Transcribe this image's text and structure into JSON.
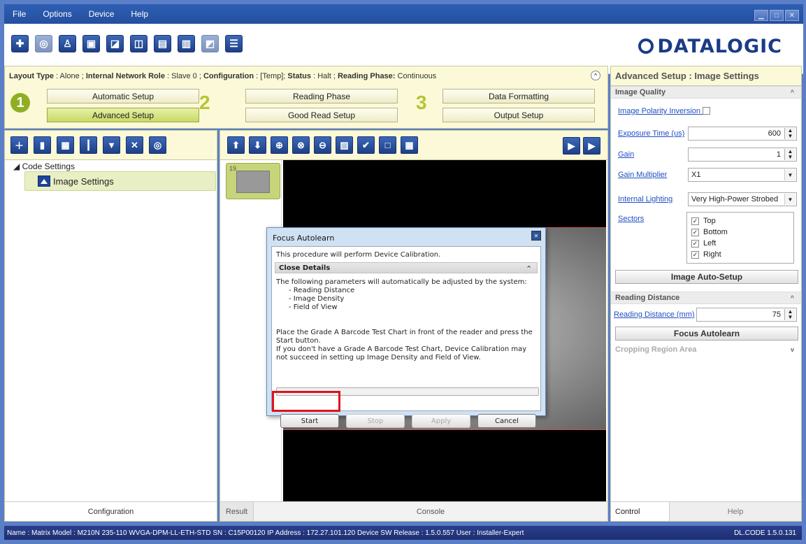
{
  "menu": [
    "File",
    "Options",
    "Device",
    "Help"
  ],
  "brand": {
    "logo_text": "DATALOGIC"
  },
  "layout_info": {
    "layout_type_label": "Layout Type",
    "layout_type_value": "Alone",
    "network_role_label": "Internal Network Role",
    "network_role_value": "Slave 0",
    "configuration_label": "Configuration",
    "configuration_value": "[Temp]",
    "status_label": "Status",
    "status_value": "Halt",
    "reading_phase_label": "Reading Phase:",
    "reading_phase_value": "Continuous"
  },
  "steps": {
    "step1": {
      "number": "1",
      "buttons": [
        "Automatic Setup",
        "Advanced Setup"
      ]
    },
    "step2": {
      "number": "2",
      "buttons": [
        "Reading Phase",
        "Good Read Setup"
      ]
    },
    "step3": {
      "number": "3",
      "buttons": [
        "Data Formatting",
        "Output Setup"
      ]
    }
  },
  "left_panel": {
    "tree_root": "Code Settings",
    "tree_item": "Image Settings",
    "footer": "Configuration"
  },
  "center_panel": {
    "thumb_number": "19",
    "footer_tabs": [
      "Result",
      "Console"
    ]
  },
  "right_panel": {
    "title": "Advanced Setup : Image Settings",
    "sections": {
      "image_quality": "Image Quality",
      "reading_distance": "Reading Distance",
      "cropping": "Cropping Region Area"
    },
    "image_polarity_label": "Image Polarity Inversion",
    "exposure_label": "Exposure Time (us)",
    "exposure_value": "600",
    "gain_label": "Gain",
    "gain_value": "1",
    "gain_multiplier_label": "Gain Multiplier",
    "gain_multiplier_value": "X1",
    "internal_lighting_label": "Internal Lighting",
    "internal_lighting_value": "Very High-Power Strobed",
    "sectors_label": "Sectors",
    "sectors": [
      "Top",
      "Bottom",
      "Left",
      "Right"
    ],
    "image_autosetup_button": "Image Auto-Setup",
    "reading_distance_label": "Reading Distance (mm)",
    "reading_distance_value": "75",
    "focus_autolearn_button": "Focus Autolearn",
    "footer_tabs": [
      "Control",
      "Help"
    ]
  },
  "dialog": {
    "title": "Focus Autolearn",
    "intro": "This procedure will perform Device Calibration.",
    "details_header": "Close Details",
    "text_line1": "The following parameters will automatically be adjusted by the system:",
    "param1": "- Reading Distance",
    "param2": "- Image Density",
    "param3": "- Field of View",
    "text_line2": "Place the Grade A Barcode Test Chart in front of the reader and press the Start button.",
    "text_line3": "If you don't have a Grade A Barcode Test Chart, Device Calibration may not succeed in setting up Image Density and Field of View.",
    "buttons": {
      "start": "Start",
      "stop": "Stop",
      "apply": "Apply",
      "cancel": "Cancel"
    }
  },
  "status_bar": {
    "text": "Name : Matrix  Model : M210N 235-110 WVGA-DPM-LL-ETH-STD  SN : C15P00120  IP Address :  172.27.101.120  Device SW Release : 1.5.0.557  User : Installer-Expert",
    "version": "DL.CODE 1.5.0.131"
  },
  "colors": {
    "accent_highlight": "#e0121c",
    "brand_blue": "#1b3b86",
    "step_green": "#b5c534"
  }
}
